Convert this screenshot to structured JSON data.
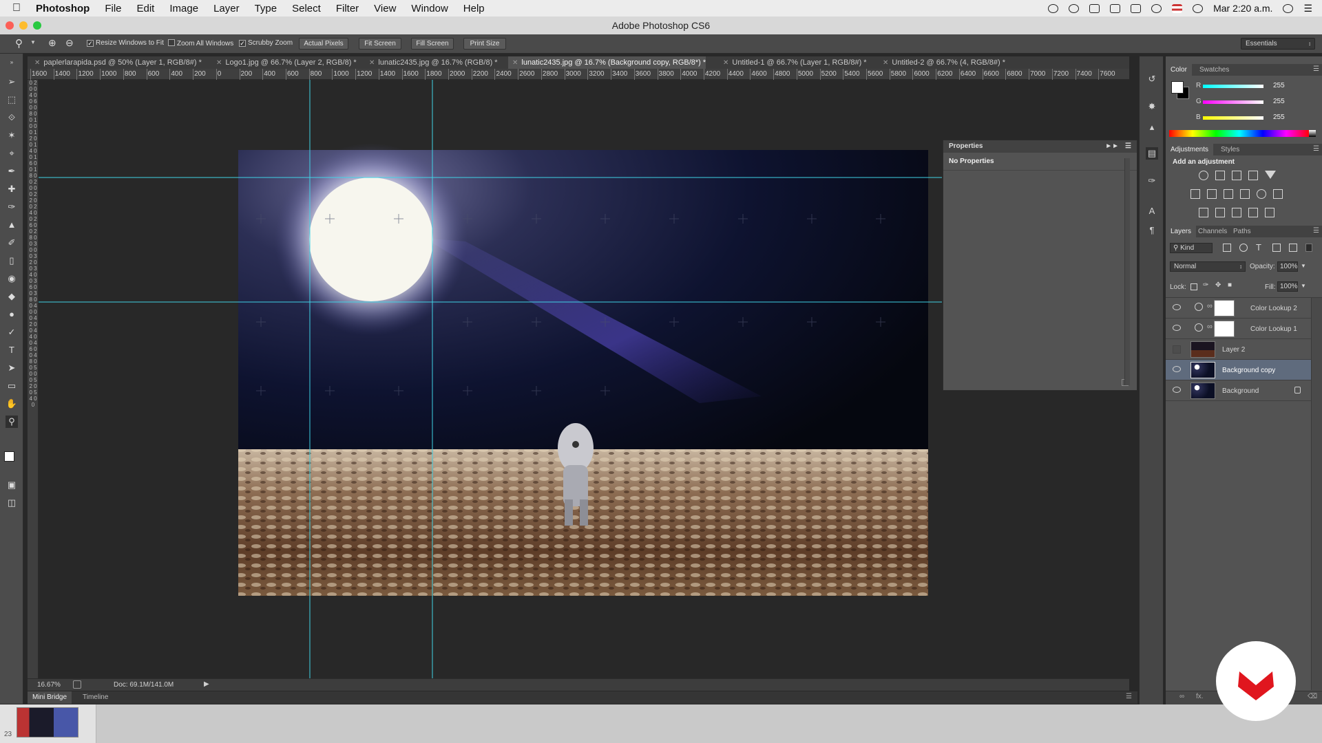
{
  "menubar": {
    "app": "Photoshop",
    "items": [
      "File",
      "Edit",
      "Image",
      "Layer",
      "Type",
      "Select",
      "Filter",
      "View",
      "Window",
      "Help"
    ],
    "clock": "Mar 2:20 a.m."
  },
  "window": {
    "title": "Adobe Photoshop CS6"
  },
  "options": {
    "resize_windows": "Resize Windows to Fit",
    "zoom_all": "Zoom All Windows",
    "scrubby": "Scrubby Zoom",
    "actual_pixels": "Actual Pixels",
    "fit_screen": "Fit Screen",
    "fill_screen": "Fill Screen",
    "print_size": "Print Size",
    "workspace": "Essentials"
  },
  "tabs": [
    "paplerlarapida.psd @ 50% (Layer 1, RGB/8#) *",
    "Logo1.jpg @ 66.7% (Layer 2, RGB/8) *",
    "lunatic2435.jpg @ 16.7% (RGB/8) *",
    "lunatic2435.jpg @ 16.7% (Background copy, RGB/8*) *",
    "Untitled-1 @ 66.7% (Layer 1, RGB/8#) *",
    "Untitled-2 @ 66.7% (4, RGB/8#) *"
  ],
  "ruler_top": [
    "1600",
    "1400",
    "1200",
    "1000",
    "800",
    "600",
    "400",
    "200",
    "0",
    "200",
    "400",
    "600",
    "800",
    "1000",
    "1200",
    "1400",
    "1600",
    "1800",
    "2000",
    "2200",
    "2400",
    "2600",
    "2800",
    "3000",
    "3200",
    "3400",
    "3600",
    "3800",
    "4000",
    "4200",
    "4400",
    "4600",
    "4800",
    "5000",
    "5200",
    "5400",
    "5600",
    "5800",
    "6000",
    "6200",
    "6400",
    "6600",
    "6800",
    "7000",
    "7200",
    "7400",
    "7600"
  ],
  "status": {
    "zoom": "16.67%",
    "doc": "Doc: 69.1M/141.0M"
  },
  "bottom_tabs": [
    "Mini Bridge",
    "Timeline"
  ],
  "properties": {
    "title": "Properties",
    "body": "No Properties"
  },
  "color_panel": {
    "tabs": [
      "Color",
      "Swatches"
    ],
    "r_label": "R",
    "g_label": "G",
    "b_label": "B",
    "r": "255",
    "g": "255",
    "b": "255"
  },
  "adjustments": {
    "tabs": [
      "Adjustments",
      "Styles"
    ],
    "add_label": "Add an adjustment"
  },
  "layers_panel": {
    "tabs": [
      "Layers",
      "Channels",
      "Paths"
    ],
    "kind": "Kind",
    "blend_mode": "Normal",
    "opacity_label": "Opacity:",
    "opacity": "100%",
    "lock_label": "Lock:",
    "fill_label": "Fill:",
    "fill": "100%",
    "layers": [
      {
        "name": "Color Lookup 2",
        "visible": true
      },
      {
        "name": "Color Lookup 1",
        "visible": true
      },
      {
        "name": "Layer 2",
        "visible": false
      },
      {
        "name": "Background copy",
        "visible": true,
        "selected": true
      },
      {
        "name": "Background",
        "visible": true,
        "locked": true
      }
    ]
  },
  "colors": {
    "guide": "#3fd3e6",
    "selection": "#5f6b7d",
    "brand_red": "#e0161e"
  },
  "minibridge_number": "23"
}
